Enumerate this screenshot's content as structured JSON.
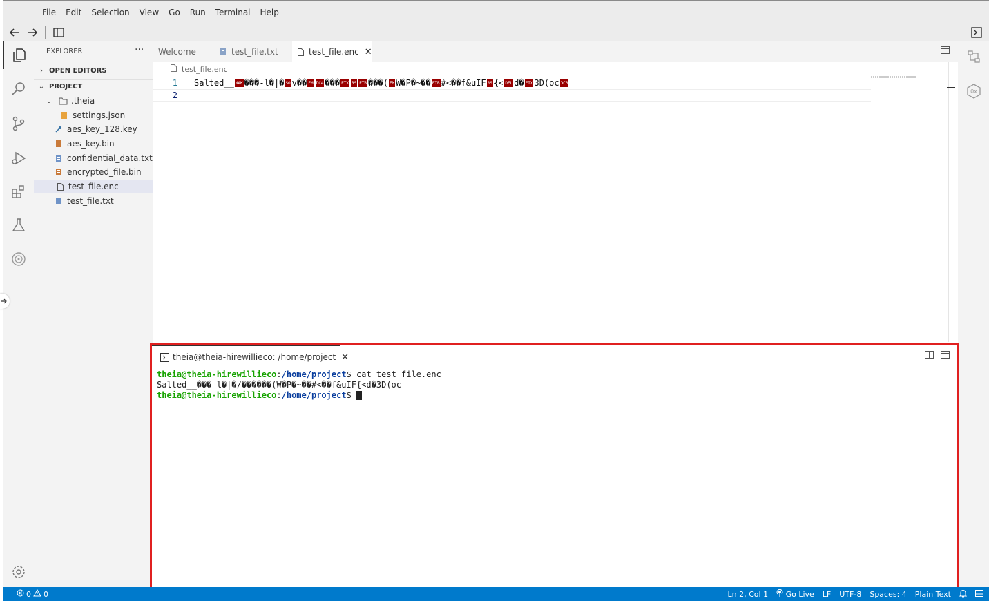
{
  "menu": [
    "File",
    "Edit",
    "Selection",
    "View",
    "Go",
    "Run",
    "Terminal",
    "Help"
  ],
  "toolbar": {
    "back_icon": "arrow-left-icon",
    "forward_icon": "arrow-right-icon",
    "panel_icon": "toggle-panel-icon",
    "terminal_icon": "terminal-icon"
  },
  "activity_bar": [
    {
      "name": "explorer-icon",
      "active": true
    },
    {
      "name": "search-icon"
    },
    {
      "name": "source-control-icon"
    },
    {
      "name": "run-debug-icon"
    },
    {
      "name": "extensions-icon"
    },
    {
      "name": "test-flask-icon"
    },
    {
      "name": "remote-icon"
    },
    {
      "name": "settings-gear-icon"
    }
  ],
  "explorer": {
    "title": "EXPLORER",
    "more": "···",
    "open_editors": "OPEN EDITORS",
    "project": "PROJECT",
    "tree": [
      {
        "label": ".theia",
        "type": "folder"
      },
      {
        "label": "settings.json",
        "type": "json"
      },
      {
        "label": "aes_key_128.key",
        "type": "key"
      },
      {
        "label": "aes_key.bin",
        "type": "bin"
      },
      {
        "label": "confidential_data.txt",
        "type": "txt"
      },
      {
        "label": "encrypted_file.bin",
        "type": "bin"
      },
      {
        "label": "test_file.enc",
        "type": "file",
        "selected": true
      },
      {
        "label": "test_file.txt",
        "type": "txt"
      }
    ]
  },
  "tabs": [
    {
      "label": "Welcome"
    },
    {
      "label": "test_file.txt"
    },
    {
      "label": "test_file.enc",
      "active": true,
      "close": "✕"
    }
  ],
  "editor": {
    "breadcrumb": "test_file.enc",
    "lines": [
      {
        "num": "1",
        "segments": [
          "Salted__",
          "NAK",
          "���-l�|�",
          "SO",
          "v��",
          "EM",
          "DC4",
          "���",
          "ETX",
          "RS",
          "ETB",
          "���(",
          "EM",
          "W�P�~��",
          "ETB",
          "#<��f&uIF",
          "RS",
          "{<",
          "DEL",
          "d�",
          "ETX",
          "3D(oc",
          "DC3"
        ]
      },
      {
        "num": "2",
        "segments": []
      }
    ]
  },
  "terminal": {
    "tab_label": "theia@theia-hirewillieco: /home/project",
    "tab_close": "✕",
    "user": "theia@theia-hirewillieco",
    "sep": ":",
    "path": "/home/project",
    "prompt": "$ ",
    "command": "cat test_file.enc",
    "output": "Salted__��� l�|�∕������(W�P�~��#<��f&uIF{<d�3D(oc"
  },
  "status": {
    "errors": "0",
    "warnings": "0",
    "position": "Ln 2, Col 1",
    "go_live": "Go Live",
    "eol": "LF",
    "encoding": "UTF-8",
    "spaces": "Spaces: 4",
    "language": "Plain Text"
  }
}
